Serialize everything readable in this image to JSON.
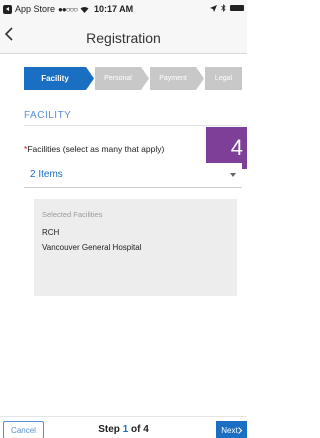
{
  "status_bar": {
    "back_app": "App Store",
    "signal": "●●○○○",
    "wifi_icon": "wifi-icon",
    "time": "10:17 AM",
    "location_icon": "location-arrow-icon",
    "bluetooth_icon": "bluetooth-icon",
    "battery_icon": "battery-icon"
  },
  "nav": {
    "back_icon": "chevron-left-icon",
    "title": "Registration"
  },
  "stepper": {
    "steps": [
      {
        "label": "Facility",
        "active": true
      },
      {
        "label": "Personal",
        "active": false
      },
      {
        "label": "Payment",
        "active": false
      },
      {
        "label": "Legal",
        "active": false
      }
    ]
  },
  "section": {
    "heading": "FACILITY",
    "step_badge": "4",
    "field_required_mark": "*",
    "field_label": "Facilities (select as many that apply)",
    "select_value": "2 Items",
    "select_icon": "caret-down-icon",
    "selected_title": "Selected Facilities",
    "selected_items": [
      "RCH",
      "Vancouver General Hospital"
    ]
  },
  "footer": {
    "cancel_label": "Cancel",
    "step_prefix": "Step ",
    "step_current": "1",
    "step_suffix": " of 4",
    "next_label": "Next"
  },
  "colors": {
    "accent": "#1a6fc2",
    "badge": "#7d3f98",
    "inactive_step": "#c8c8c8",
    "required": "#d0021b"
  }
}
